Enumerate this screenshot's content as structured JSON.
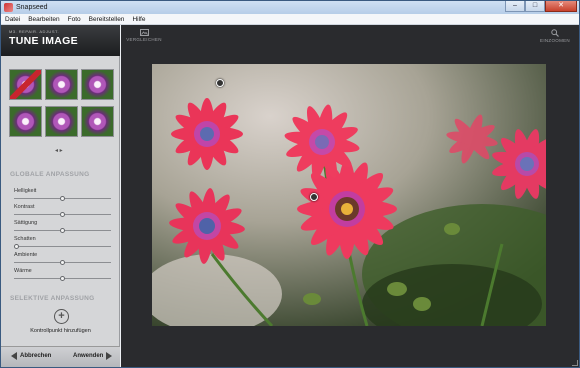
{
  "window": {
    "title": "Snapseed",
    "minimize": "–",
    "maximize": "□",
    "close": "✕"
  },
  "menu": [
    "Datei",
    "Bearbeiten",
    "Foto",
    "Bereitstellen",
    "Hilfe"
  ],
  "tool": {
    "kicker": "M3. REPAIR. ADJUST.",
    "title": "TUNE IMAGE"
  },
  "pager": "◂ ▸",
  "global": {
    "title": "GLOBALE ANPASSUNG",
    "sliders": [
      {
        "label": "Helligkeit",
        "value": 0.5
      },
      {
        "label": "Kontrast",
        "value": 0.5
      },
      {
        "label": "Sättigung",
        "value": 0.5
      },
      {
        "label": "Schatten",
        "value": 0.0
      },
      {
        "label": "Ambiente",
        "value": 0.5
      },
      {
        "label": "Wärme",
        "value": 0.5
      }
    ]
  },
  "selective": {
    "title": "SELEKTIVE ANPASSUNG",
    "add_label": "Kontrollpunkt hinzufügen",
    "add_icon": "plus-icon"
  },
  "footer": {
    "cancel": "Abbrechen",
    "apply": "Anwenden"
  },
  "main": {
    "compare": "VERGLEICHEN",
    "zoom": "EINZOOMEN"
  }
}
